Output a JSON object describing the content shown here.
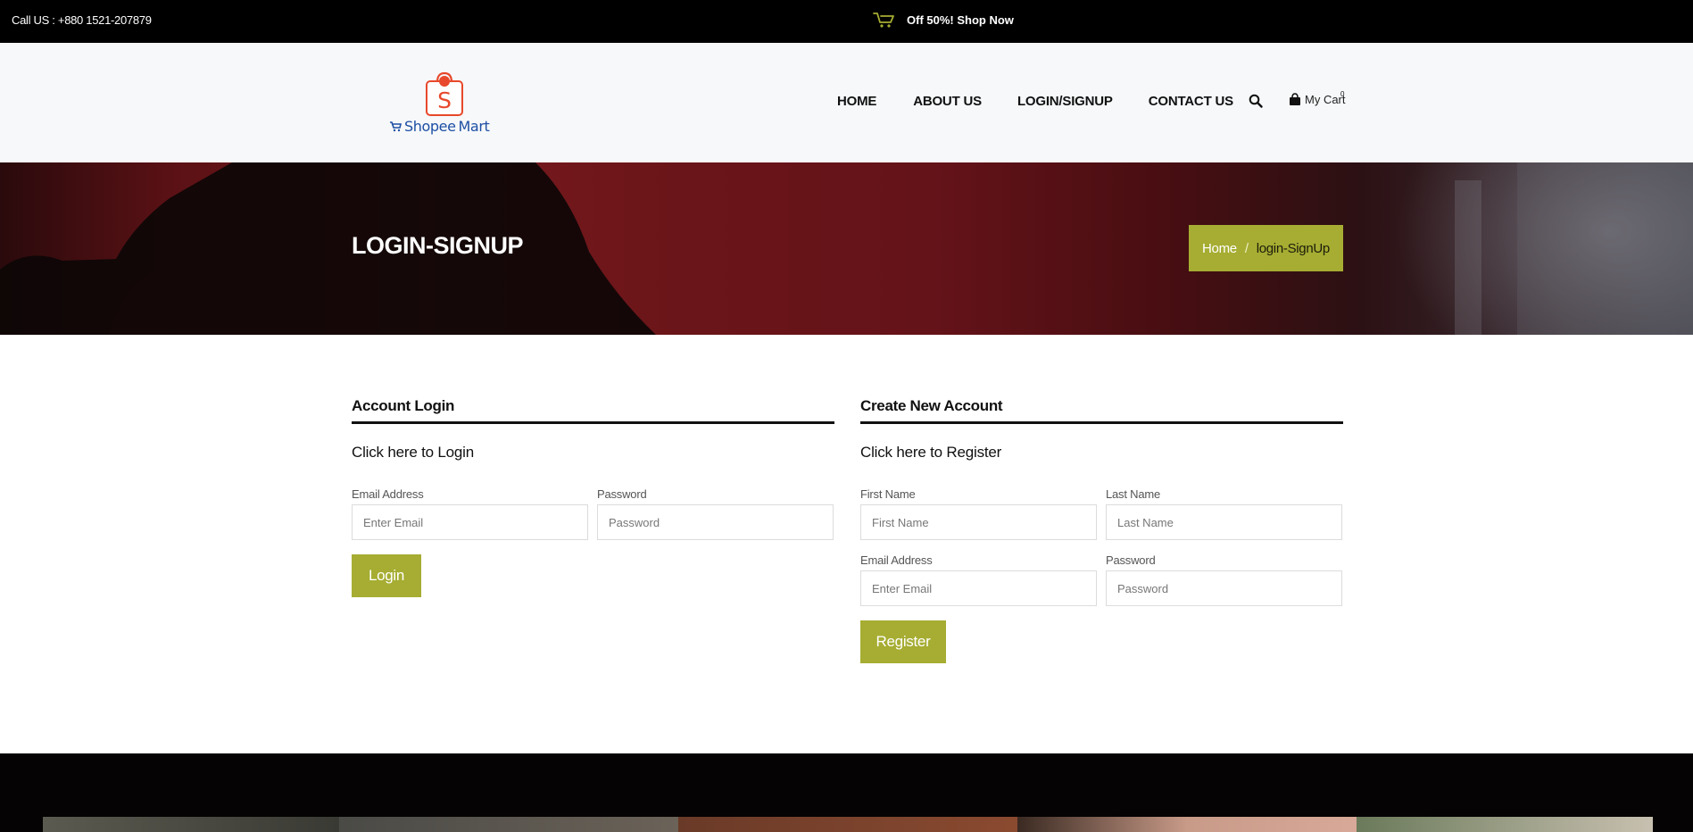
{
  "topbar": {
    "call_text": "Call US : +880 1521-207879",
    "promo_text": "Off 50%! Shop Now"
  },
  "header": {
    "logo": {
      "brand_first": "Shopee",
      "brand_second": "Mart",
      "bag_letter": "S"
    },
    "nav": [
      {
        "label": "HOME"
      },
      {
        "label": "ABOUT US"
      },
      {
        "label": "LOGIN/SIGNUP"
      },
      {
        "label": "CONTACT US"
      }
    ],
    "cart_label": "My Cart",
    "cart_count": "0"
  },
  "hero": {
    "title": "LOGIN-SIGNUP",
    "breadcrumb": {
      "home": "Home",
      "separator": "/",
      "current": "login-SignUp"
    }
  },
  "login": {
    "heading": "Account Login",
    "subheading": "Click here to Login",
    "email_label": "Email Address",
    "email_placeholder": "Enter Email",
    "password_label": "Password",
    "password_placeholder": "Password",
    "button": "Login"
  },
  "register": {
    "heading": "Create New Account",
    "subheading": "Click here to Register",
    "first_name_label": "First Name",
    "first_name_placeholder": "First Name",
    "last_name_label": "Last Name",
    "last_name_placeholder": "Last Name",
    "email_label": "Email Address",
    "email_placeholder": "Enter Email",
    "password_label": "Password",
    "password_placeholder": "Password",
    "button": "Register"
  },
  "colors": {
    "accent": "#a6ad32",
    "topbar": "#000000",
    "header_bg": "#f6f8fa",
    "hero_red": "#7a1a1e"
  },
  "icons": {
    "promo": "shopping-cart-icon",
    "search": "search-icon",
    "cart": "shopping-bag-icon"
  }
}
